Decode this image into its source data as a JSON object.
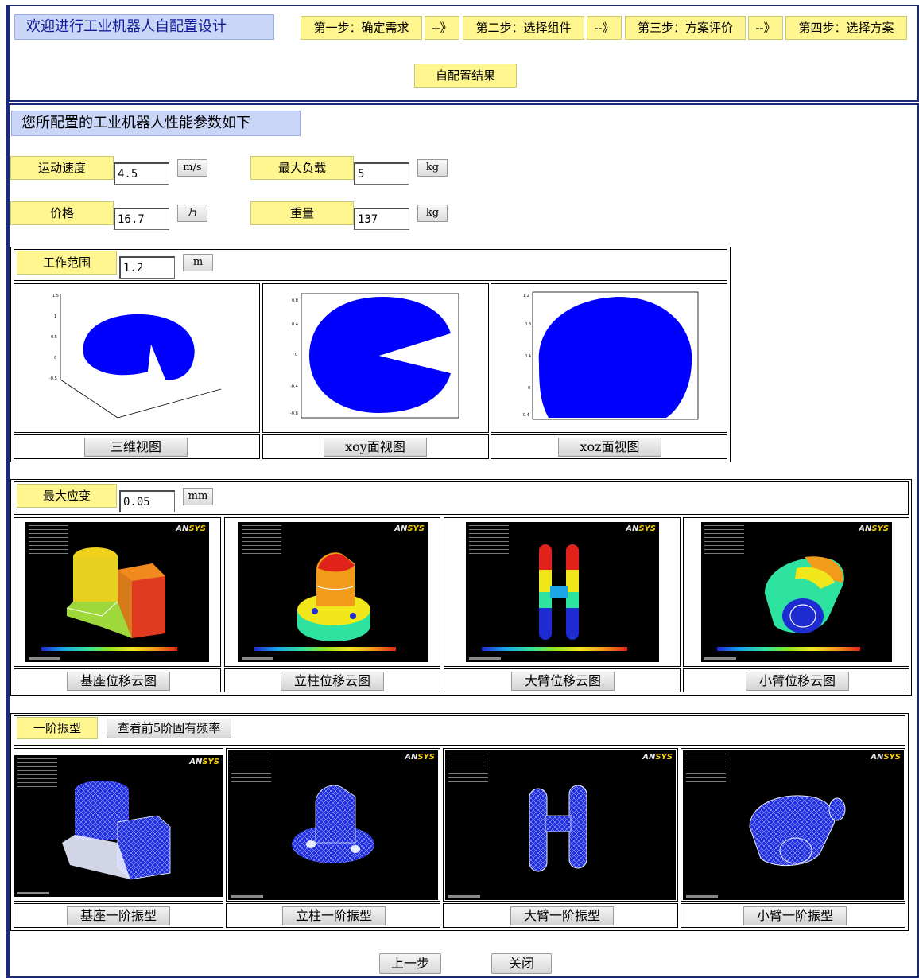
{
  "header": {
    "welcome": "欢迎进行工业机器人自配置设计",
    "steps": [
      "第一步：确定需求",
      "--》",
      "第二步：选择组件",
      "--》",
      "第三步：方案评价",
      "--》",
      "第四步：选择方案"
    ],
    "result_label": "自配置结果"
  },
  "section_title": "您所配置的工业机器人性能参数如下",
  "params": {
    "speed": {
      "label": "运动速度",
      "value": "4.5",
      "unit": "m/s"
    },
    "load": {
      "label": "最大负载",
      "value": "5",
      "unit": "kg"
    },
    "price": {
      "label": "价格",
      "value": "16.7",
      "unit": "万"
    },
    "weight": {
      "label": "重量",
      "value": "137",
      "unit": "kg"
    }
  },
  "workspace": {
    "label": "工作范围",
    "value": "1.2",
    "unit": "m",
    "views": [
      "三维视图",
      "xoy面视图",
      "xoz面视图"
    ]
  },
  "strain": {
    "label": "最大应变",
    "value": "0.05",
    "unit": "mm",
    "images": [
      "基座位移云图",
      "立柱位移云图",
      "大臂位移云图",
      "小臂位移云图"
    ]
  },
  "vibration": {
    "label": "一阶振型",
    "button": "查看前5阶固有频率",
    "images": [
      "基座一阶振型",
      "立柱一阶振型",
      "大臂一阶振型",
      "小臂一阶振型"
    ]
  },
  "footer": {
    "prev": "上一步",
    "close": "关闭"
  },
  "colors": {
    "accent_yellow": "#fff68f",
    "accent_blue": "#c9d6f8",
    "frame": "#1c2a7a",
    "plot_blue": "#0000ff"
  }
}
